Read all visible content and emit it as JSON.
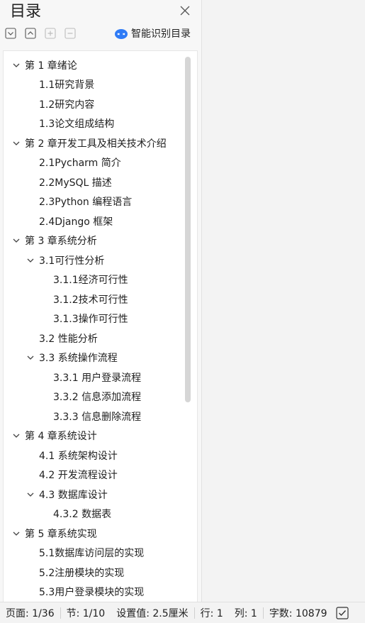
{
  "panel": {
    "title": "目录",
    "smart_label": "智能识别目录"
  },
  "toolbar": {
    "icons": [
      "collapse-all-icon",
      "expand-all-icon",
      "add-level-icon",
      "remove-level-icon"
    ]
  },
  "toc": [
    {
      "label": "第 1 章绪论",
      "level": 1,
      "expanded": true
    },
    {
      "label": "1.1研究背景",
      "level": 2
    },
    {
      "label": "1.2研究内容",
      "level": 2
    },
    {
      "label": "1.3论文组成结构",
      "level": 2
    },
    {
      "label": "第 2 章开发工具及相关技术介绍",
      "level": 1,
      "expanded": true
    },
    {
      "label": "2.1Pycharm 简介",
      "level": 2
    },
    {
      "label": "2.2MySQL 描述",
      "level": 2
    },
    {
      "label": "2.3Python 编程语言",
      "level": 2
    },
    {
      "label": "2.4Django 框架",
      "level": 2
    },
    {
      "label": "第 3 章系统分析",
      "level": 1,
      "expanded": true
    },
    {
      "label": "3.1可行性分析",
      "level": 2,
      "expanded": true
    },
    {
      "label": "3.1.1经济可行性",
      "level": 3
    },
    {
      "label": "3.1.2技术可行性",
      "level": 3
    },
    {
      "label": "3.1.3操作可行性",
      "level": 3
    },
    {
      "label": "3.2 性能分析",
      "level": 2
    },
    {
      "label": "3.3 系统操作流程",
      "level": 2,
      "expanded": true
    },
    {
      "label": "3.3.1 用户登录流程",
      "level": 3
    },
    {
      "label": "3.3.2 信息添加流程",
      "level": 3
    },
    {
      "label": "3.3.3 信息删除流程",
      "level": 3
    },
    {
      "label": "第 4 章系统设计",
      "level": 1,
      "expanded": true
    },
    {
      "label": "4.1 系统架构设计",
      "level": 2
    },
    {
      "label": "4.2 开发流程设计",
      "level": 2
    },
    {
      "label": "4.3 数据库设计",
      "level": 2,
      "expanded": true
    },
    {
      "label": "4.3.2 数据表",
      "level": 3
    },
    {
      "label": "第 5 章系统实现",
      "level": 1,
      "expanded": true
    },
    {
      "label": "5.1数据库访问层的实现",
      "level": 2
    },
    {
      "label": "5.2注册模块的实现",
      "level": 2
    },
    {
      "label": "5.3用户登录模块的实现",
      "level": 2
    }
  ],
  "status": {
    "page": "页面: 1/36",
    "section": "节: 1/10",
    "setting": "设置值: 2.5厘米",
    "line": "行: 1",
    "column": "列: 1",
    "wordcount": "字数: 10879"
  },
  "colors": {
    "accent": "#2f7bf6",
    "icon": "#555555"
  }
}
